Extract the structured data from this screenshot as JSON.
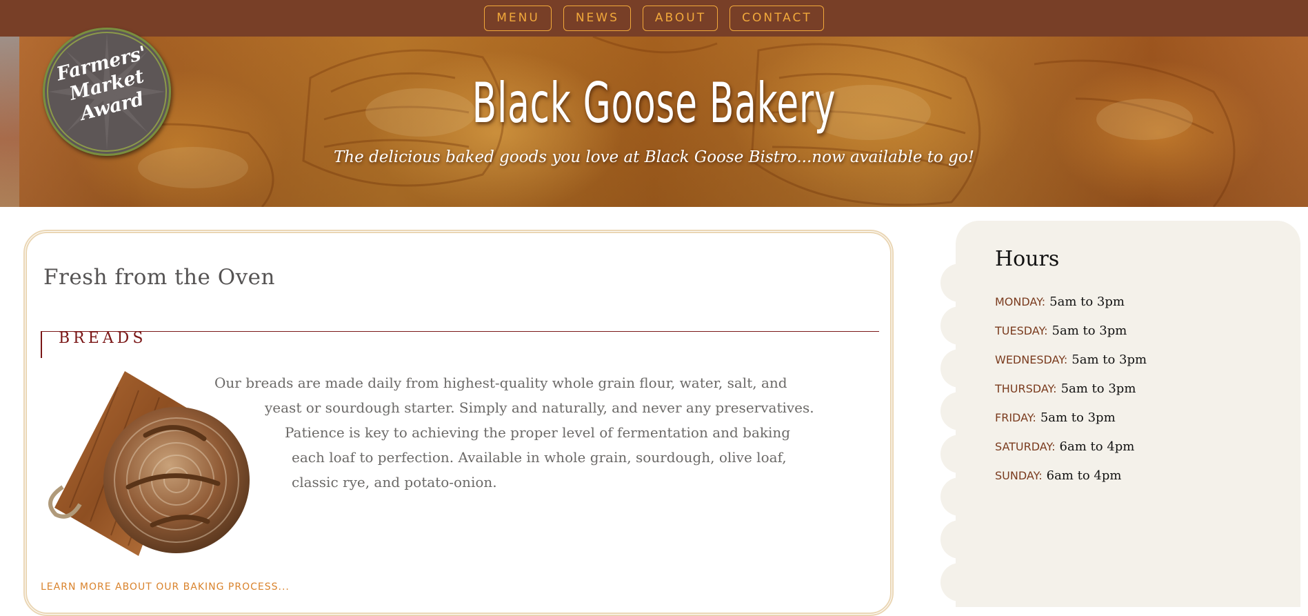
{
  "nav": {
    "items": [
      {
        "label": "MENU"
      },
      {
        "label": "NEWS"
      },
      {
        "label": "ABOUT"
      },
      {
        "label": "CONTACT"
      }
    ]
  },
  "hero": {
    "title": "Black Goose Bakery",
    "tagline": "The delicious baked goods you love at Black Goose Bistro...now available to go!",
    "award": {
      "line1": "Farmers'",
      "line2": "Market",
      "line3": "Award"
    }
  },
  "main": {
    "title": "Fresh from the Oven",
    "section_heading": "BREADS",
    "paragraph_lines": [
      "Our breads are made daily from highest-quality whole grain flour, water, salt, and",
      "yeast or sourdough starter. Simply and naturally, and never any preservatives.",
      "Patience is key to achieving the proper level of fermentation and baking",
      "each loaf to perfection. Available in whole grain, sourdough, olive loaf,",
      "classic rye, and potato-onion."
    ],
    "learn_more": "LEARN MORE ABOUT OUR BAKING PROCESS..."
  },
  "sidebar": {
    "title": "Hours",
    "hours": [
      {
        "day": "Monday:",
        "time": "5am to 3pm"
      },
      {
        "day": "Tuesday:",
        "time": "5am to 3pm"
      },
      {
        "day": "Wednesday:",
        "time": "5am to 3pm"
      },
      {
        "day": "Thursday:",
        "time": "5am to 3pm"
      },
      {
        "day": "Friday:",
        "time": "5am to 3pm"
      },
      {
        "day": "Saturday:",
        "time": "6am to 4pm"
      },
      {
        "day": "Sunday:",
        "time": "6am to 4pm"
      }
    ]
  },
  "colors": {
    "nav_background": "#783f27",
    "nav_accent": "#f2a93b",
    "heading_red": "#7a1616",
    "link_orange": "#d9822b",
    "sidebar_background": "#f4f1ea"
  }
}
